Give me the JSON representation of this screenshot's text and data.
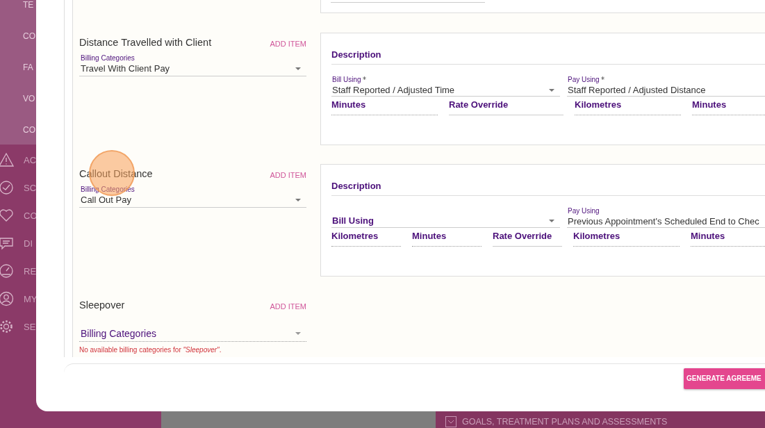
{
  "sidebar": {
    "upper_items": [
      {
        "label": "TE"
      },
      {
        "label": "CO"
      },
      {
        "label": "FA"
      },
      {
        "label": "VO"
      },
      {
        "label": "CO"
      }
    ],
    "lower_items": [
      {
        "label": "AC"
      },
      {
        "label": "SC"
      },
      {
        "label": "CO"
      },
      {
        "label": "DI"
      },
      {
        "label": "RE"
      },
      {
        "label": "MY"
      },
      {
        "label": "SE"
      }
    ]
  },
  "sections": [
    {
      "title": "Distance Travelled with Client",
      "add_label": "ADD ITEM",
      "billing": {
        "label": "Billing Categories",
        "value": "Travel With Client Pay"
      },
      "card": {
        "description_label": "Description",
        "bill_using": {
          "label": "Bill Using",
          "required": true,
          "value": "Staff Reported / Adjusted Time"
        },
        "pay_using": {
          "label": "Pay Using",
          "required": true,
          "value": "Staff Reported / Adjusted Distance"
        },
        "fields": [
          {
            "label": "Minutes",
            "kind": "measure"
          },
          {
            "label": "Rate Override",
            "kind": "override"
          },
          {
            "label": "Kilometres",
            "kind": "measure"
          },
          {
            "label": "Minutes",
            "kind": "measure"
          }
        ]
      }
    },
    {
      "title": "Callout Distance",
      "add_label": "ADD ITEM",
      "billing": {
        "label": "Billing Categories",
        "value": "Call Out Pay"
      },
      "card": {
        "description_label": "Description",
        "bill_using": {
          "label": "Bill Using",
          "required": false
        },
        "pay_using": {
          "label": "Pay Using",
          "required": false,
          "value": "Previous Appointment's Scheduled End to Chec"
        },
        "fields": [
          {
            "label": "Kilometres",
            "kind": "measure"
          },
          {
            "label": "Minutes",
            "kind": "measure"
          },
          {
            "label": "Rate Override",
            "kind": "override"
          },
          {
            "label": "Kilometres",
            "kind": "measure"
          },
          {
            "label": "Minutes",
            "kind": "measure"
          }
        ]
      }
    },
    {
      "title": "Sleepover",
      "add_label": "ADD ITEM",
      "billing": {
        "label": "Billing Categories",
        "error": "No available billing categories for *\"Sleepover\"*."
      }
    }
  ],
  "footer": {
    "button": "GENERATE AGREEME"
  },
  "background_panel": {
    "title": "GOALS, TREATMENT PLANS AND ASSESSMENTS"
  }
}
